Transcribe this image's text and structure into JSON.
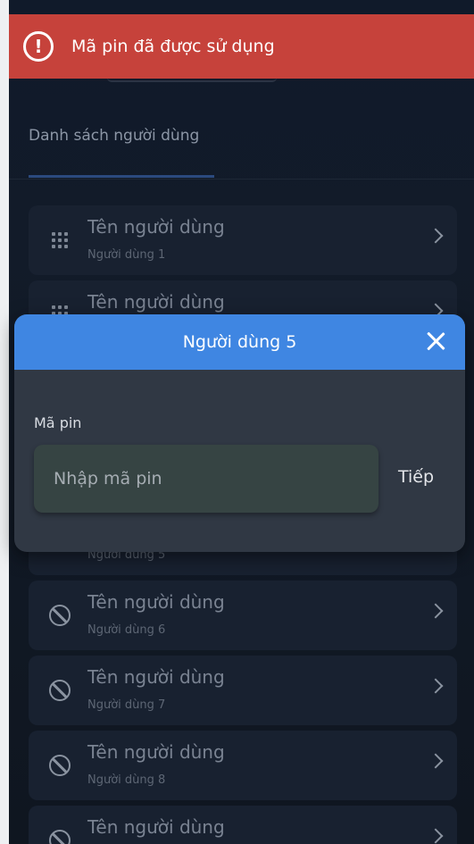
{
  "toast": {
    "icon": "alert-circle-icon",
    "message": "Mã pin đã được sử dụng",
    "color": "#c6423b"
  },
  "tabs": {
    "active_label": "Danh sách người dùng"
  },
  "users": [
    {
      "title": "Tên người dùng",
      "subtitle": "Người dùng 1",
      "icon": "keypad-icon"
    },
    {
      "title": "Tên người dùng",
      "subtitle": "",
      "icon": "keypad-icon"
    },
    {
      "title": "",
      "subtitle": "Người dùng 5",
      "icon": "ban-icon"
    },
    {
      "title": "Tên người dùng",
      "subtitle": "Người dùng 6",
      "icon": "ban-icon"
    },
    {
      "title": "Tên người dùng",
      "subtitle": "Người dùng 7",
      "icon": "ban-icon"
    },
    {
      "title": "Tên người dùng",
      "subtitle": "Người dùng 8",
      "icon": "ban-icon"
    },
    {
      "title": "Tên người dùng",
      "subtitle": "",
      "icon": "ban-icon"
    }
  ],
  "modal": {
    "title": "Người dùng 5",
    "field_label": "Mã pin",
    "input_placeholder": "Nhập mã pin",
    "input_value": "",
    "next_label": "Tiếp",
    "accent": "#3f86e2"
  }
}
